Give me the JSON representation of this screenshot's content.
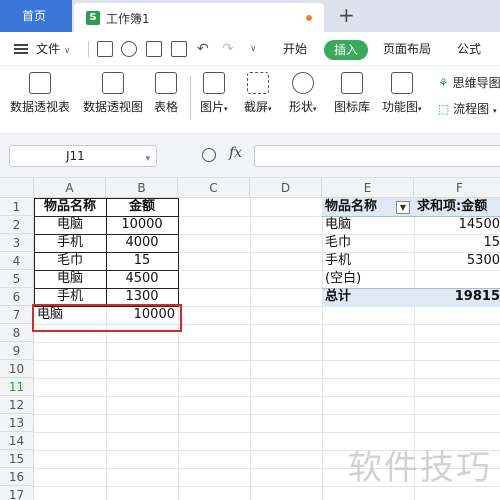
{
  "tabs": {
    "home": "首页",
    "document": "工作簿1",
    "document_icon": "S",
    "add": "+"
  },
  "menu": {
    "file": "文件",
    "start": "开始",
    "insert": "插入",
    "page_layout": "页面布局",
    "formula": "公式"
  },
  "ribbon": {
    "pivot_table": "数据透视表",
    "pivot_chart": "数据透视图",
    "table": "表格",
    "picture": "图片",
    "screenshot": "截屏",
    "shape": "形状",
    "icon_lib": "图标库",
    "function_chart": "功能图",
    "mind_map": "思维导图",
    "flow_chart": "流程图"
  },
  "formula_bar": {
    "name_box": "J11",
    "fx": "fx",
    "value": ""
  },
  "columns": [
    "A",
    "B",
    "C",
    "D",
    "E",
    "F"
  ],
  "rows": [
    "1",
    "2",
    "3",
    "4",
    "5",
    "6",
    "7",
    "8",
    "9",
    "10",
    "11",
    "12",
    "13",
    "14",
    "15",
    "16",
    "17"
  ],
  "active_row": "11",
  "sheet": {
    "a1": "物品名称",
    "b1": "金额",
    "a2": "电脑",
    "b2": "10000",
    "a3": "手机",
    "b3": "4000",
    "a4": "毛巾",
    "b4": "15",
    "a5": "电脑",
    "b5": "4500",
    "a6": "手机",
    "b6": "1300",
    "a7": "电脑",
    "b7": "10000"
  },
  "pivot": {
    "header_e": "物品名称",
    "header_f": "求和项:金额",
    "filter_glyph": "▼",
    "r2_e": "电脑",
    "r2_f": "14500",
    "r3_e": "毛巾",
    "r3_f": "15",
    "r4_e": "手机",
    "r4_f": "5300",
    "r5_e": "(空白)",
    "r5_f": "",
    "total_e": "总计",
    "total_f": "19815"
  },
  "watermark": "软件技巧",
  "colors": {
    "accent_green": "#3aaa5c",
    "home_tab_blue": "#3b77d9",
    "highlight_red": "#d42a2a",
    "pivot_blue": "#dfe8f3"
  }
}
